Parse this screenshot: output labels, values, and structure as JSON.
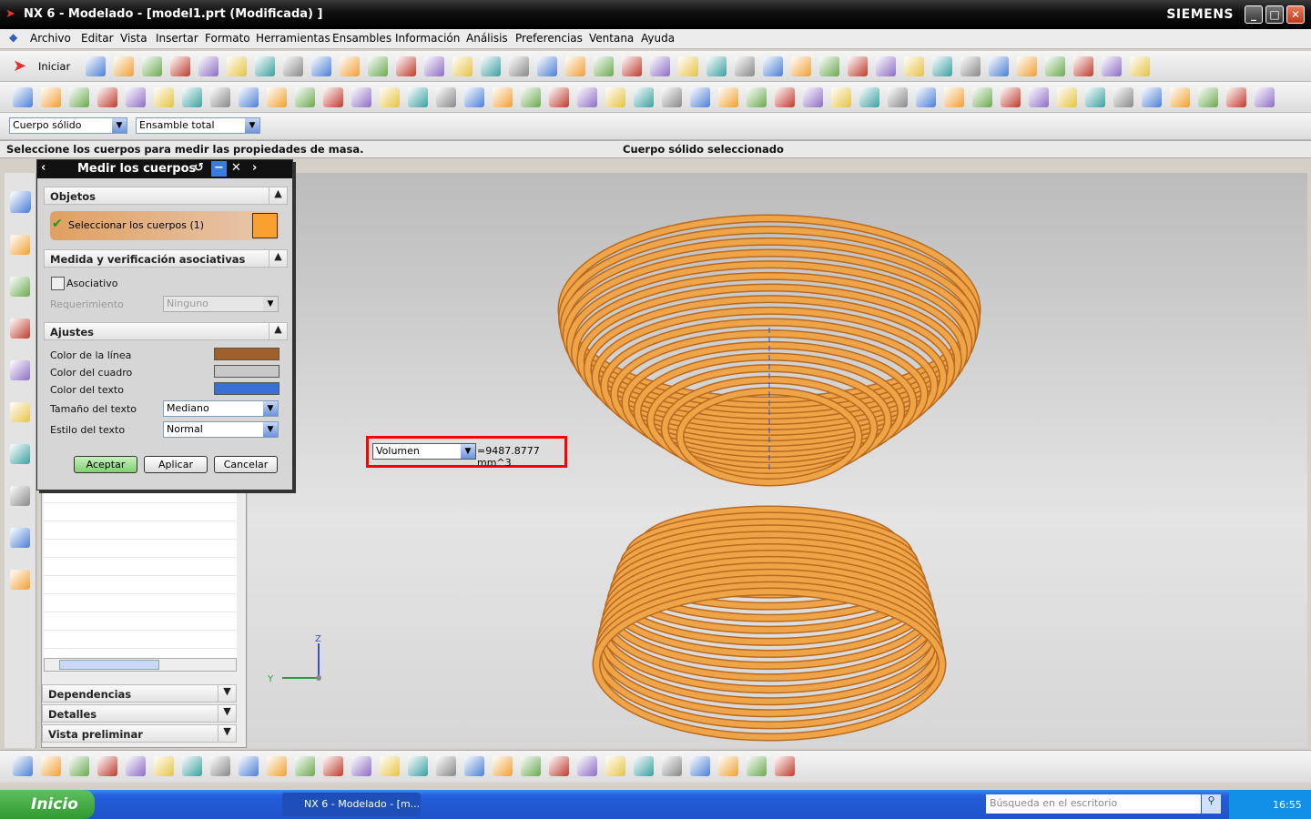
{
  "window": {
    "title": "NX 6 - Modelado - [model1.prt (Modificada) ]",
    "brand": "SIEMENS",
    "min": "_",
    "max": "□",
    "close": "✕"
  },
  "menu": [
    "Archivo",
    "Editar",
    "Vista",
    "Insertar",
    "Formato",
    "Herramientas",
    "Ensambles",
    "Información",
    "Análisis",
    "Preferencias",
    "Ventana",
    "Ayuda"
  ],
  "toolbar": {
    "start_label": "Iniciar",
    "filter1": "Cuerpo sólido",
    "filter2": "Ensamble total"
  },
  "cue": {
    "prompt": "Seleccione los cuerpos para medir las propiedades de masa.",
    "status": "Cuerpo sólido seleccionado"
  },
  "dialog": {
    "title": "Medir los cuerpos",
    "groups": {
      "objects": "Objetos",
      "assoc": "Medida y verificación asociativas",
      "settings": "Ajustes"
    },
    "select_bodies": "Seleccionar los cuerpos (1)",
    "associative": "Asociativo",
    "associative_checked": false,
    "requirement_label": "Requerimiento",
    "requirement_value": "Ninguno",
    "line_color_label": "Color de la línea",
    "box_color_label": "Color del cuadro",
    "text_color_label": "Color del texto",
    "text_size_label": "Tamaño del texto",
    "text_size": "Mediano",
    "text_style_label": "Estilo del texto",
    "text_style": "Normal",
    "colors": {
      "line": "#a0602a",
      "box": "#c8c8c8",
      "text": "#3a6fd8"
    },
    "ok": "Aceptar",
    "apply": "Aplicar",
    "cancel": "Cancelar"
  },
  "navigator": {
    "sections": [
      "Dependencias",
      "Detalles",
      "Vista preliminar"
    ]
  },
  "measurement": {
    "type": "Volumen",
    "value": "=9487.8777 mm^3"
  },
  "triad": {
    "z": "Z",
    "y": "Y"
  },
  "taskbar": {
    "start": "Inicio",
    "task": "NX 6 - Modelado - [m...",
    "search_placeholder": "Búsqueda en el escritorio",
    "clock": "16:55"
  },
  "colors": {
    "model": "#f0a448",
    "highlight": "#ff0000"
  }
}
